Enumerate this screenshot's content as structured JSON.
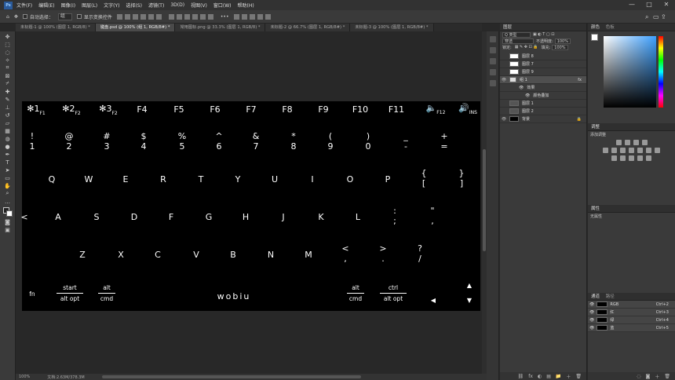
{
  "menubar": {
    "logo": "Ps",
    "items": [
      "文件(F)",
      "编辑(E)",
      "图像(I)",
      "图层(L)",
      "文字(Y)",
      "选择(S)",
      "滤镜(T)",
      "3D(D)",
      "视图(V)",
      "窗口(W)",
      "帮助(H)"
    ],
    "window_controls": [
      "—",
      "□",
      "✕"
    ]
  },
  "options": {
    "auto_select": "自动选择：",
    "layer_select": "组",
    "show_transform": "显示变换控件"
  },
  "tabs": [
    {
      "label": "未标题-1 @ 100% (图层 1, RGB/8) *",
      "active": false
    },
    {
      "label": "键盘.psd @ 100% (组 1, RGB/8#) *",
      "active": true
    },
    {
      "label": "常用图标.png @ 33.3% (图层 1, RGB/8) *",
      "active": false
    },
    {
      "label": "未标题-2 @ 66.7% (图层 1, RGB/8#) *",
      "active": false
    },
    {
      "label": "未标题-3 @ 100% (图层 1, RGB/8#) *",
      "active": false
    }
  ],
  "keyboard": {
    "fkeys": [
      {
        "main": "✻1",
        "sub": "F1"
      },
      {
        "main": "✻2",
        "sub": "F2"
      },
      {
        "main": "✻3",
        "sub": "F2"
      },
      {
        "main": "F4",
        "sub": ""
      },
      {
        "main": "F5",
        "sub": ""
      },
      {
        "main": "F6",
        "sub": ""
      },
      {
        "main": "F7",
        "sub": ""
      },
      {
        "main": "F8",
        "sub": ""
      },
      {
        "main": "F9",
        "sub": ""
      },
      {
        "main": "F10",
        "sub": ""
      },
      {
        "main": "F11",
        "sub": ""
      },
      {
        "main": "🔈",
        "sub": "F12"
      },
      {
        "main": "🔊",
        "sub": "INS"
      }
    ],
    "numbers": [
      {
        "top": "!",
        "bot": "1"
      },
      {
        "top": "@",
        "bot": "2"
      },
      {
        "top": "#",
        "bot": "3"
      },
      {
        "top": "$",
        "bot": "4"
      },
      {
        "top": "%",
        "bot": "5"
      },
      {
        "top": "^",
        "bot": "6"
      },
      {
        "top": "&",
        "bot": "7"
      },
      {
        "top": "*",
        "bot": "8"
      },
      {
        "top": "(",
        "bot": "9"
      },
      {
        "top": ")",
        "bot": "0"
      },
      {
        "top": "_",
        "bot": "-"
      },
      {
        "top": "+",
        "bot": "="
      }
    ],
    "row_q": [
      "Q",
      "W",
      "E",
      "R",
      "T",
      "Y",
      "U",
      "I",
      "O",
      "P"
    ],
    "row_q_extra": [
      {
        "top": "{",
        "bot": "["
      },
      {
        "top": "}",
        "bot": "]"
      }
    ],
    "row_a_left": "<",
    "row_a": [
      "A",
      "S",
      "D",
      "F",
      "G",
      "H",
      "J",
      "K",
      "L"
    ],
    "row_a_extra": [
      {
        "top": ":",
        "bot": ";"
      },
      {
        "top": "\"",
        "bot": ","
      }
    ],
    "row_z": [
      "Z",
      "X",
      "C",
      "V",
      "B",
      "N",
      "M"
    ],
    "row_z_extra": [
      {
        "top": "<",
        "bot": ","
      },
      {
        "top": ">",
        "bot": "."
      },
      {
        "top": "?",
        "bot": "/"
      }
    ],
    "bottom": {
      "fn": "fn",
      "start": {
        "top": "start",
        "bot": "alt opt"
      },
      "alt_left": {
        "top": "alt",
        "bot": "cmd"
      },
      "space": "wobiu",
      "alt_right": {
        "top": "alt",
        "bot": "cmd"
      },
      "ctrl": {
        "top": "ctrl",
        "bot": "alt opt"
      },
      "arrow_up": "▲",
      "arrow_left": "◀",
      "arrow_down": "▼"
    }
  },
  "status": {
    "zoom": "100%",
    "doc": "文档:2.63M/378.3M"
  },
  "layers_panel": {
    "title": "图层",
    "kind": "Q 类型",
    "blend": "穿透",
    "opacity_label": "不透明度:",
    "opacity": "100%",
    "lock_label": "锁定:",
    "fill_label": "填充:",
    "fill": "100%",
    "layers": [
      {
        "name": "图层 8",
        "selected": false,
        "fx": ""
      },
      {
        "name": "图层 7",
        "selected": false,
        "fx": ""
      },
      {
        "name": "图层 9",
        "selected": false,
        "fx": ""
      },
      {
        "name": "组 1",
        "selected": true,
        "fx": "fx"
      },
      {
        "name": "效果",
        "selected": false,
        "fx": ""
      },
      {
        "name": "颜色叠加",
        "selected": false,
        "fx": ""
      },
      {
        "name": "图层 1",
        "selected": false,
        "fx": ""
      },
      {
        "name": "图层 2",
        "selected": false,
        "fx": ""
      },
      {
        "name": "背景",
        "selected": false,
        "fx": "🔒"
      }
    ],
    "footer": [
      "⛓",
      "fx",
      "◐",
      "▤",
      "📁",
      "＋",
      "🗑"
    ]
  },
  "color_panel": {
    "title": "颜色",
    "tab2": "色板"
  },
  "adjust_panel": {
    "title": "调整",
    "subtitle": "添加调整"
  },
  "props_panel": {
    "title": "属性",
    "text": "无属性"
  },
  "channels_panel": {
    "title": "通道",
    "tab2": "路径",
    "channels": [
      {
        "name": "RGB",
        "shortcut": "Ctrl+2"
      },
      {
        "name": "红",
        "shortcut": "Ctrl+3"
      },
      {
        "name": "绿",
        "shortcut": "Ctrl+4"
      },
      {
        "name": "蓝",
        "shortcut": "Ctrl+5"
      }
    ]
  }
}
